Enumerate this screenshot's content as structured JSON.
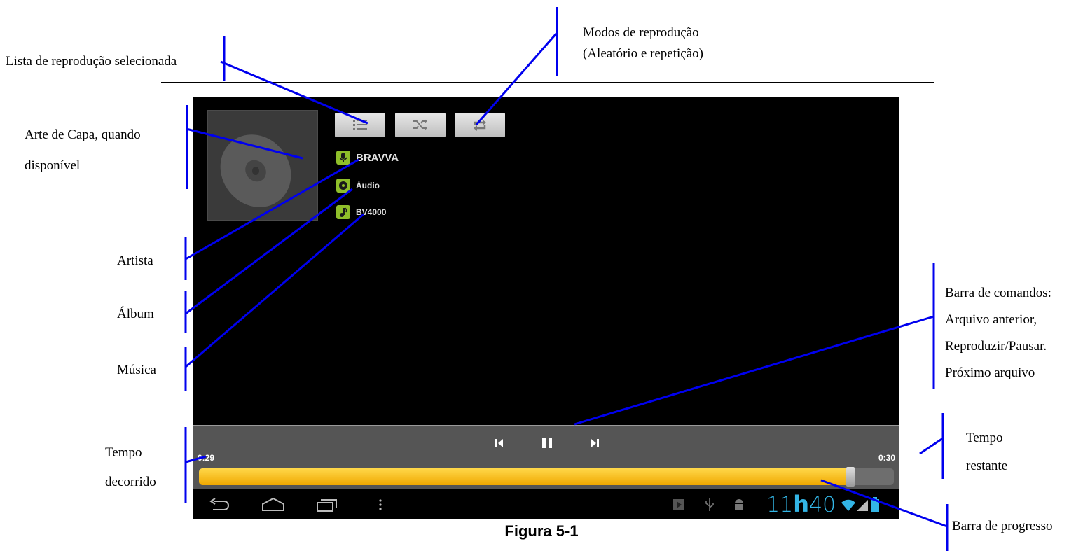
{
  "annotations": {
    "playlist": "Lista de reprodução selecionada",
    "modes_line1": "Modos de reprodução",
    "modes_line2": "(Aleatório e repetição)",
    "cover_line1": "Arte de Capa, quando",
    "cover_line2": "disponível",
    "artist": "Artista",
    "album": "Álbum",
    "music": "Música",
    "commands_line1": "Barra de comandos:",
    "commands_line2": "Arquivo anterior,",
    "commands_line3": "Reproduzir/Pausar.",
    "commands_line4": "Próximo arquivo",
    "remaining_line1": "Tempo",
    "remaining_line2": "restante",
    "elapsed_line1": "Tempo",
    "elapsed_line2": "decorrido",
    "progress": "Barra de progresso"
  },
  "player": {
    "artist": "BRAVVA",
    "album": "Áudio",
    "track": "BV4000",
    "elapsed": "0:29",
    "remaining": "0:30",
    "progress_fraction": 0.937
  },
  "statusbar": {
    "clock_hours": "11",
    "clock_sep": "h",
    "clock_minutes": "40"
  },
  "caption": "Figura 5-1",
  "colors": {
    "callout_line": "#0000ee",
    "progress_fill": "#f5b800",
    "clock": "#33b5e5",
    "info_icon": "#8fbf2a"
  },
  "icons": [
    "playlist-icon",
    "shuffle-icon",
    "repeat-icon",
    "microphone-icon",
    "album-disc-icon",
    "music-note-icon",
    "previous-icon",
    "pause-icon",
    "next-icon",
    "back-icon",
    "home-icon",
    "recent-apps-icon",
    "menu-icon",
    "media-play-icon",
    "usb-icon",
    "android-debug-icon",
    "wifi-icon",
    "signal-icon",
    "battery-icon"
  ]
}
